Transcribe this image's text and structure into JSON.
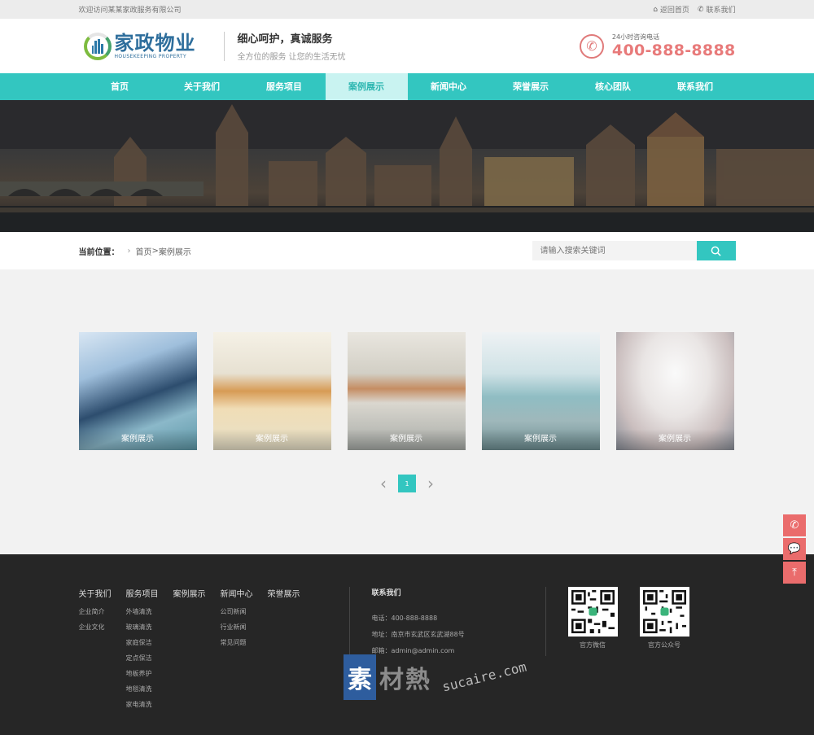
{
  "topbar": {
    "welcome": "欢迎访问某某家政服务有限公司",
    "home_link": "返回首页",
    "contact_link": "联系我们"
  },
  "logo": {
    "cn": "家政物业",
    "en": "HOUSEKEEPING PROPERTY"
  },
  "slogan": {
    "title": "细心呵护，真诚服务",
    "sub": "全方位的服务 让您的生活无忧"
  },
  "hotline": {
    "label": "24小时咨询电话",
    "number": "400-888-8888"
  },
  "nav": [
    "首页",
    "关于我们",
    "服务项目",
    "案例展示",
    "新闻中心",
    "荣誉展示",
    "核心团队",
    "联系我们"
  ],
  "breadcrumb": {
    "label": "当前位置：",
    "home": "首页",
    "sep": ">",
    "current": "案例展示"
  },
  "search": {
    "placeholder": "请输入搜索关键词"
  },
  "cases": [
    {
      "caption": "案例展示"
    },
    {
      "caption": "案例展示"
    },
    {
      "caption": "案例展示"
    },
    {
      "caption": "案例展示"
    },
    {
      "caption": "案例展示"
    }
  ],
  "pager": {
    "current": "1"
  },
  "footer": {
    "cols": [
      {
        "title": "关于我们",
        "items": [
          "企业简介",
          "企业文化"
        ]
      },
      {
        "title": "服务项目",
        "items": [
          "外墙清洗",
          "玻璃清洗",
          "家庭保洁",
          "定点保洁",
          "地板养护",
          "地毯清洗",
          "家电清洗"
        ]
      },
      {
        "title": "案例展示",
        "items": []
      },
      {
        "title": "新闻中心",
        "items": [
          "公司新闻",
          "行业新闻",
          "常见问题"
        ]
      },
      {
        "title": "荣誉展示",
        "items": []
      }
    ],
    "contact": {
      "title": "联系我们",
      "tel": "电话：400-888-8888",
      "addr": "地址：南京市玄武区玄武湖88号",
      "email": "邮箱：admin@admin.com"
    },
    "qr1": "官方微信",
    "qr2": "官方公众号"
  },
  "watermark": {
    "badge": "素",
    "cn": "材熱",
    "en": "sucaire.com"
  },
  "colors": {
    "accent": "#33c6c0",
    "hotline": "#e87a7a",
    "footer_bg": "#262626"
  }
}
